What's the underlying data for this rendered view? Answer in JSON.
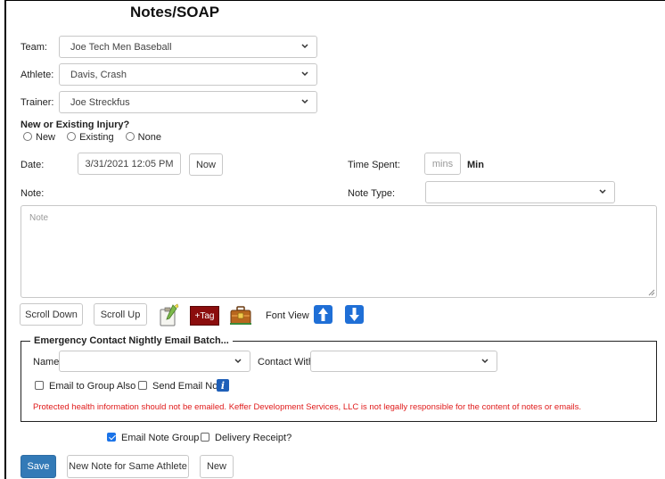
{
  "page": {
    "title": "Notes/SOAP"
  },
  "team": {
    "label": "Team:",
    "value": "Joe Tech Men Baseball"
  },
  "athlete": {
    "label": "Athlete:",
    "value": "Davis, Crash"
  },
  "trainer": {
    "label": "Trainer:",
    "value": "Joe Streckfus"
  },
  "injury": {
    "label": "New or Existing Injury?",
    "options": [
      "New",
      "Existing",
      "None"
    ]
  },
  "date": {
    "label": "Date:",
    "value": "3/31/2021 12:05 PM",
    "now_label": "Now"
  },
  "time_spent": {
    "label": "Time Spent:",
    "placeholder": "mins",
    "unit": "Min"
  },
  "note": {
    "label": "Note:",
    "placeholder": "Note"
  },
  "note_type": {
    "label": "Note Type:",
    "value": ""
  },
  "toolbar": {
    "scroll_down": "Scroll Down",
    "scroll_up": "Scroll Up",
    "tag": "+Tag",
    "font_view": "Font View"
  },
  "emergency": {
    "legend": "Emergency Contact Nightly Email Batch...",
    "name_label": "Name:",
    "name_value": "",
    "contact_with_label": "Contact With:",
    "contact_with_value": "",
    "email_group_also": "Email to Group Also",
    "send_email_now": "Send Email Now",
    "warning": "Protected health information should not be emailed. Keffer Development Services, LLC is not legally responsible for the content of notes or emails."
  },
  "options": {
    "email_note_group": "Email Note Group",
    "email_note_group_checked": true,
    "delivery_receipt": "Delivery Receipt?",
    "delivery_receipt_checked": false
  },
  "actions": {
    "save": "Save",
    "new_same_athlete": "New Note for Same Athlete",
    "new": "New"
  },
  "colors": {
    "primary": "#337ab7",
    "warning": "#e01b1b",
    "tag_bg": "#8b0d0d",
    "arrow_blue": "#1f6fd6"
  }
}
